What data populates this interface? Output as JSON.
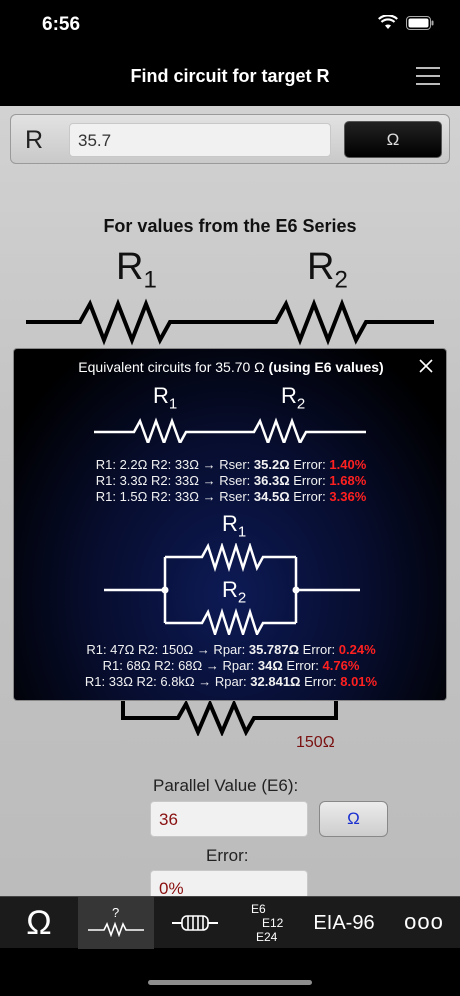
{
  "status_bar": {
    "time": "6:56"
  },
  "nav": {
    "title": "Find circuit for target R"
  },
  "input": {
    "label": "R",
    "value": "35.7",
    "unit_button": "Ω"
  },
  "background": {
    "series_title": "For values from the E6 Series",
    "r1_label": "R",
    "r1_sub": "1",
    "r2_label": "R",
    "r2_sub": "2",
    "bottom_value": "150Ω",
    "parallel_label": "Parallel Value (E6):",
    "parallel_value": "36",
    "parallel_unit": "Ω",
    "error_label": "Error:",
    "error_value": "0%"
  },
  "popup": {
    "title_prefix": "Equivalent circuits for 35.70 Ω",
    "title_bold": "(using E6 values)",
    "r1_label": "R",
    "r1_sub": "1",
    "r2_label": "R",
    "r2_sub": "2",
    "series_results": [
      {
        "text": "R1: 2.2Ω R2: 33Ω → Rser:",
        "value": "35.2Ω",
        "err_label": "Error:",
        "err": "1.40%"
      },
      {
        "text": "R1: 3.3Ω R2: 33Ω → Rser:",
        "value": "36.3Ω",
        "err_label": "Error:",
        "err": "1.68%"
      },
      {
        "text": "R1: 1.5Ω R2: 33Ω → Rser:",
        "value": "34.5Ω",
        "err_label": "Error:",
        "err": "3.36%"
      }
    ],
    "parallel_results": [
      {
        "text": "R1: 47Ω R2: 150Ω → Rpar:",
        "value": "35.787Ω",
        "err_label": "Error:",
        "err": "0.24%"
      },
      {
        "text": "R1: 68Ω R2: 68Ω → Rpar:",
        "value": "34Ω",
        "err_label": "Error:",
        "err": "4.76%"
      },
      {
        "text": "R1: 33Ω R2: 6.8kΩ → Rpar:",
        "value": "32.841Ω",
        "err_label": "Error:",
        "err": "8.01%"
      }
    ]
  },
  "tabs": {
    "ohm": "Ω",
    "question": "?",
    "e6": "E6",
    "e12": "E12",
    "e24": "E24",
    "eia": "EIA-96",
    "more": "ooo"
  },
  "colors": {
    "error_red": "#ff2020",
    "link_blue": "#1a2fd0",
    "value_red": "#8a1010"
  }
}
